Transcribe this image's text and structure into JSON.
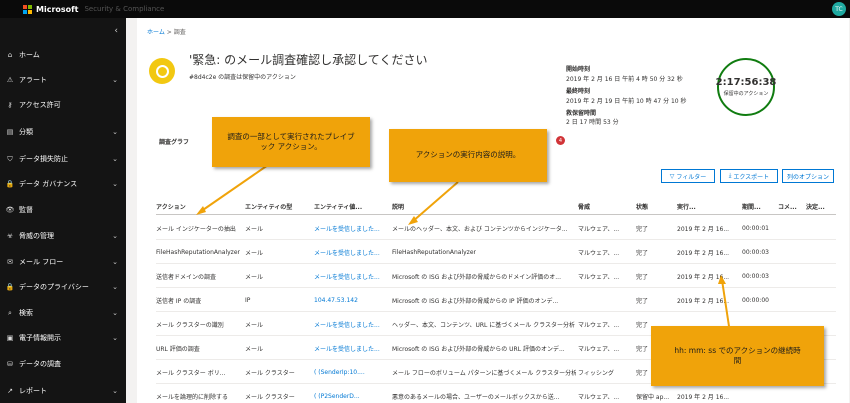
{
  "topbar": {
    "brand": "Microsoft",
    "brand_sub": "Security & Compliance",
    "avatar": "TC"
  },
  "sidebar": {
    "collapse": "‹",
    "items": [
      {
        "icon": "⌂",
        "label": "ホーム",
        "chevron": ""
      },
      {
        "icon": "⚠",
        "label": "アラート",
        "chevron": "⌄"
      },
      {
        "icon": "⚷",
        "label": "アクセス許可",
        "chevron": ""
      },
      {
        "icon": "▤",
        "label": "分類",
        "chevron": "⌄"
      },
      {
        "icon": "⛉",
        "label": "データ損失防止",
        "chevron": "⌄"
      },
      {
        "icon": "🔒",
        "label": "データ ガバナンス",
        "chevron": "⌄"
      },
      {
        "icon": "👁",
        "label": "監督",
        "chevron": ""
      },
      {
        "icon": "☣",
        "label": "脅威の管理",
        "chevron": "⌄"
      },
      {
        "icon": "✉",
        "label": "メール フロー",
        "chevron": "⌄"
      },
      {
        "icon": "🔒",
        "label": "データのプライバシー",
        "chevron": "⌄"
      },
      {
        "icon": "⌕",
        "label": "検索",
        "chevron": "⌄"
      },
      {
        "icon": "▣",
        "label": "電子情報開示",
        "chevron": "⌄"
      },
      {
        "icon": "⛁",
        "label": "データの調査",
        "chevron": ""
      },
      {
        "icon": "↗",
        "label": "レポート",
        "chevron": "⌄"
      }
    ]
  },
  "breadcrumb": {
    "home": "ホーム",
    "sep": ">",
    "current": "調査"
  },
  "header": {
    "title": "'緊急: のメール調査確認し承認してください",
    "subtitle": "#8d4c2e の調査は保留中のアクション"
  },
  "info": {
    "start_label": "開始時刻",
    "start_value": "2019 年 2 月 16 日 午前 4 時 50 分 32 秒",
    "end_label": "最終時刻",
    "end_value": "2019 年 2 月 19 日 午前 10 時 47 分 10 秒",
    "pending_label": "救保留時間",
    "pending_value": "2 日 17 時間 53 分"
  },
  "timer": {
    "value": "2:17:56:38",
    "label": "保留中のアクション"
  },
  "tabs": {
    "first": "調査グラフ",
    "partial": "ン",
    "badge": "4"
  },
  "toolbar": {
    "filter": "フィルター",
    "export": "エクスポート",
    "columns": "列のオプション"
  },
  "table": {
    "headers": [
      "アクション",
      "エンティティの型",
      "エンティティ値...",
      "説明",
      "脅威",
      "状態",
      "実行...",
      "期間...",
      "コメ...",
      "決定..."
    ],
    "rows": [
      [
        "メール インジケーターの抽出",
        "メール",
        "メールを受信しました...",
        "メールのヘッダー、本文、および コンテンツからインジケータ...",
        "マルウェア、...",
        "完了",
        "2019 年 2 月 16...",
        "00:00:01",
        "",
        ""
      ],
      [
        "FileHashReputationAnalyzer",
        "メール",
        "メールを受信しました...",
        "FileHashReputationAnalyzer",
        "マルウェア、...",
        "完了",
        "2019 年 2 月 16...",
        "00:00:03",
        "",
        ""
      ],
      [
        "送信者ドメインの調査",
        "メール",
        "メールを受信しました...",
        "Microsoft の ISG および外部の脅威からのドメイン評価のオ...",
        "マルウェア、...",
        "完了",
        "2019 年 2 月 16...",
        "00:00:03",
        "",
        ""
      ],
      [
        "送信者 IP の調査",
        "IP",
        "104.47.53.142",
        "Microsoft の ISG および外部の脅威からの IP 評価のオンデ...",
        "",
        "完了",
        "2019 年 2 月 16...",
        "00:00:00",
        "",
        ""
      ],
      [
        "メール クラスターの識別",
        "メール",
        "メールを受信しました...",
        "ヘッダー、本文、コンテンツ、URL に基づくメール クラスター分析",
        "マルウェア、...",
        "完了",
        "",
        "",
        "",
        ""
      ],
      [
        "URL 評価の調査",
        "メール",
        "メールを受信しました...",
        "Microsoft の ISG および外部の脅威からの URL 評価のオンデ...",
        "マルウェア、...",
        "完了",
        "",
        "",
        "",
        ""
      ],
      [
        "メール クラスター ボリ...",
        "メール クラスター",
        "( (SenderIp:10....",
        "メール フローのボリューム パターンに基づくメール クラスター分析",
        "フィッシング",
        "完了",
        "",
        "",
        "",
        ""
      ],
      [
        "メールを論理的に削除する",
        "メール クラスター",
        "( (P2SenderD...",
        "悪意のあるメールの場合、ユーザーのメールボックスから送...",
        "マルウェア、...",
        "保留中 ap...",
        "2019 年 2 月 16...",
        "",
        "",
        ""
      ]
    ]
  },
  "callouts": {
    "playbook": "調査の一部として実行されたプレイブック アクション。",
    "description": "アクションの実行内容の説明。",
    "duration": "hh: mm: ss でのアクションの継続時間"
  },
  "colors": {
    "accent": "#0078d4",
    "callout": "#f0a30a",
    "timer_ring": "#107c10",
    "badge": "#d13438"
  }
}
